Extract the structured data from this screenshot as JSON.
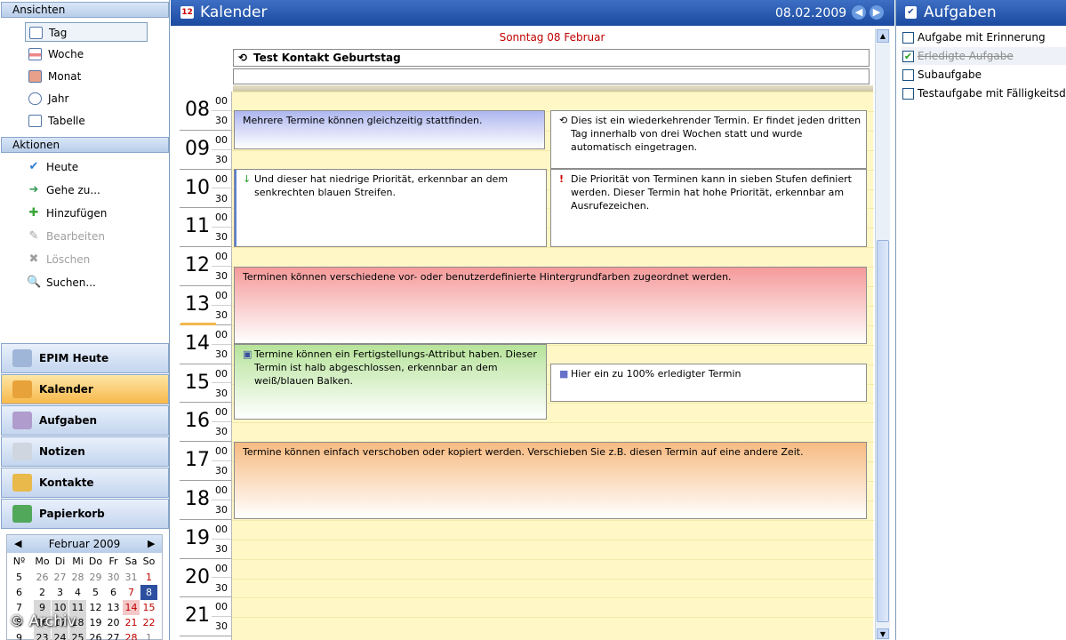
{
  "views": {
    "header": "Ansichten",
    "items": [
      {
        "label": "Tag",
        "selected": true
      },
      {
        "label": "Woche",
        "selected": false
      },
      {
        "label": "Monat",
        "selected": false
      },
      {
        "label": "Jahr",
        "selected": false
      },
      {
        "label": "Tabelle",
        "selected": false
      }
    ]
  },
  "actions": {
    "header": "Aktionen",
    "items": [
      {
        "label": "Heute",
        "enabled": true,
        "icon": "check-calendar-icon"
      },
      {
        "label": "Gehe zu...",
        "enabled": true,
        "icon": "goto-icon"
      },
      {
        "label": "Hinzufügen",
        "enabled": true,
        "icon": "plus-icon"
      },
      {
        "label": "Bearbeiten",
        "enabled": false,
        "icon": "edit-icon"
      },
      {
        "label": "Löschen",
        "enabled": false,
        "icon": "delete-icon"
      },
      {
        "label": "Suchen...",
        "enabled": true,
        "icon": "search-icon"
      }
    ]
  },
  "nav": [
    {
      "label": "EPIM Heute",
      "selected": false,
      "color": "#9fb6d8"
    },
    {
      "label": "Kalender",
      "selected": true,
      "color": "#e8a23a"
    },
    {
      "label": "Aufgaben",
      "selected": false,
      "color": "#b09ccd"
    },
    {
      "label": "Notizen",
      "selected": false,
      "color": "#cfd6df"
    },
    {
      "label": "Kontakte",
      "selected": false,
      "color": "#e9b94b"
    },
    {
      "label": "Papierkorb",
      "selected": false,
      "color": "#52a85a"
    }
  ],
  "mini_calendar": {
    "month_label": "Februar 2009",
    "weekdays": [
      "Nº",
      "Mo",
      "Di",
      "Mi",
      "Do",
      "Fr",
      "Sa",
      "So"
    ],
    "weeks": [
      {
        "wk": "5",
        "days": [
          "26",
          "27",
          "28",
          "29",
          "30",
          "31",
          "1"
        ]
      },
      {
        "wk": "6",
        "days": [
          "2",
          "3",
          "4",
          "5",
          "6",
          "7",
          "8"
        ]
      },
      {
        "wk": "7",
        "days": [
          "9",
          "10",
          "11",
          "12",
          "13",
          "14",
          "15"
        ]
      },
      {
        "wk": "8",
        "days": [
          "16",
          "17",
          "18",
          "19",
          "20",
          "21",
          "22"
        ]
      },
      {
        "wk": "9",
        "days": [
          "23",
          "24",
          "25",
          "26",
          "27",
          "28",
          "1"
        ]
      }
    ]
  },
  "calendar": {
    "title": "Kalender",
    "date": "08.02.2009",
    "day_header": "Sonntag 08 Februar",
    "allday_event": "Test Kontakt Geburtstag",
    "hours": [
      "08",
      "09",
      "10",
      "11",
      "12",
      "13",
      "14",
      "15",
      "16",
      "17",
      "18",
      "19",
      "20",
      "21"
    ],
    "minutes": [
      "00",
      "30"
    ],
    "events": [
      {
        "text": "Mehrere Termine können gleichzeitig stattfinden.",
        "color": "#aeb7ef",
        "icon": ""
      },
      {
        "text": "Dies ist ein wiederkehrender Termin. Er findet jeden dritten Tag innerhalb von drei Wochen statt und wurde automatisch eingetragen.",
        "color": "#ffffff",
        "icon": "recurring-icon"
      },
      {
        "text": "Und dieser hat niedrige Priorität, erkennbar an dem senkrechten blauen Streifen.",
        "color": "#ffffff",
        "icon": "low-priority-icon"
      },
      {
        "text": "Die Priorität von Terminen kann in sieben Stufen definiert werden. Dieser Termin hat hohe Priorität, erkennbar am Ausrufezeichen.",
        "color": "#ffffff",
        "icon": "high-priority-icon"
      },
      {
        "text": "Terminen können verschiedene vor- oder benutzerdefinierte Hintergrundfarben zugeordnet werden.",
        "color": "#f59a9a",
        "icon": ""
      },
      {
        "text": "Termine können ein Fertigstellungs-Attribut haben. Dieser Termin ist halb abgeschlossen, erkennbar an dem weiß/blauen Balken.",
        "color": "#b6e39a",
        "icon": "half-complete-icon"
      },
      {
        "text": "Hier ein zu 100% erledigter Termin",
        "color": "#ffffff",
        "icon": "complete-icon"
      },
      {
        "text": "Termine können einfach verschoben oder kopiert werden. Verschieben Sie z.B. diesen Termin auf eine andere Zeit.",
        "color": "#f7bb82",
        "icon": ""
      }
    ]
  },
  "tasks": {
    "title": "Aufgaben",
    "items": [
      {
        "label": "Aufgabe mit Erinnerung",
        "done": false
      },
      {
        "label": "Erledigte Aufgabe",
        "done": true
      },
      {
        "label": "Subaufgabe",
        "done": false
      },
      {
        "label": "Testaufgabe mit Fälligkeitsda",
        "done": false
      }
    ]
  },
  "watermark": "© Archiv"
}
